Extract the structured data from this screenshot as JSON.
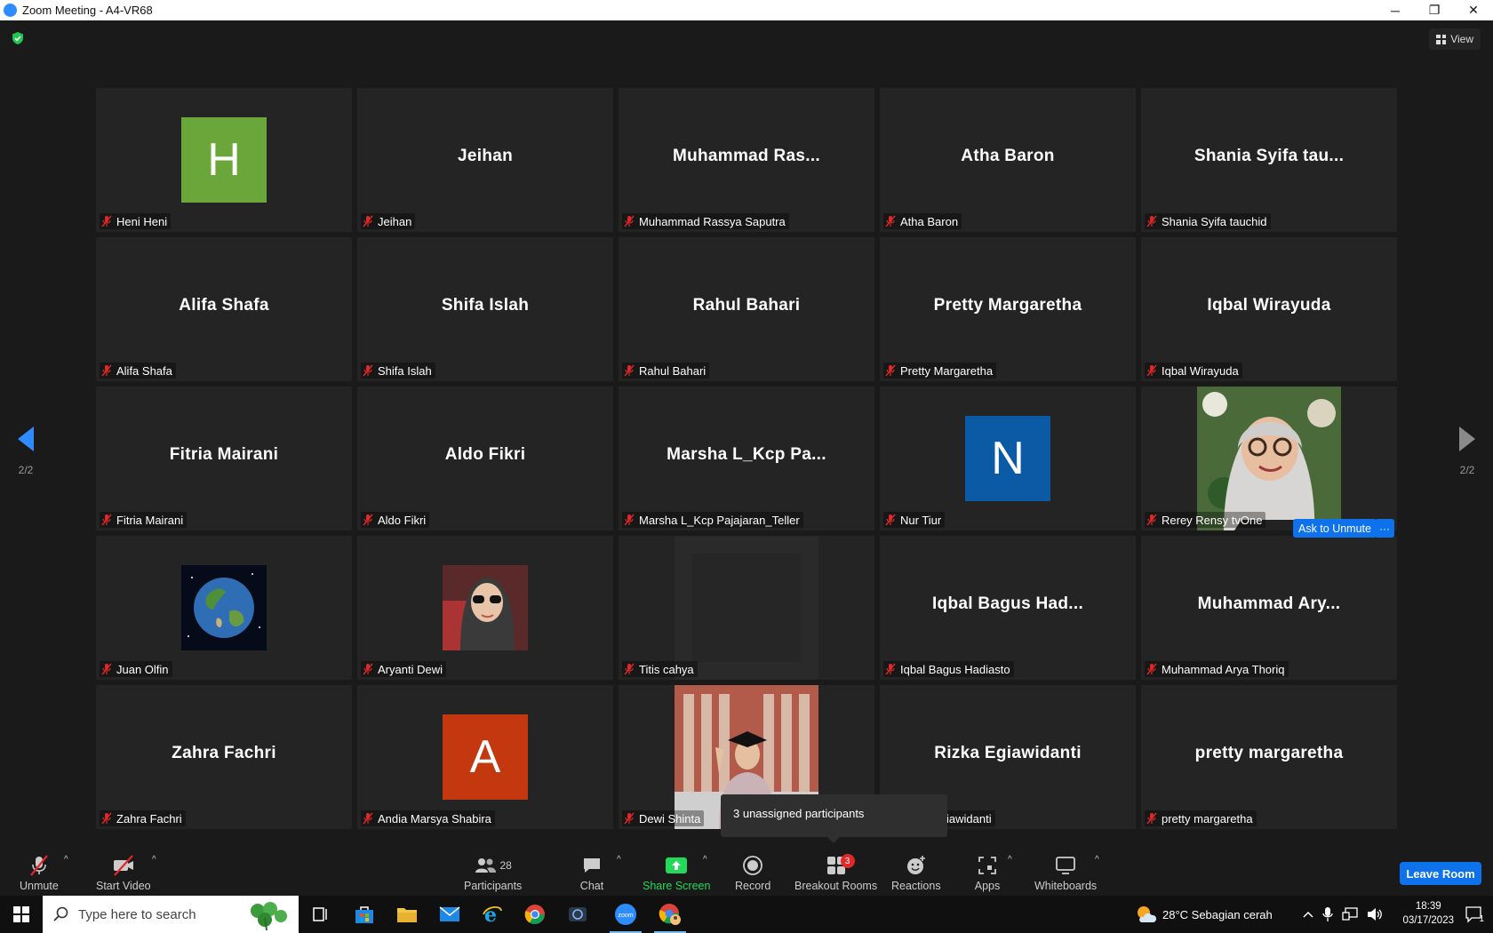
{
  "window": {
    "title": "Zoom Meeting - A4-VR68",
    "minimize": "─",
    "restore": "❐",
    "close": "✕"
  },
  "top": {
    "view_label": "View"
  },
  "pagination": {
    "prev_page": "2/2",
    "next_page": "2/2"
  },
  "tiles": [
    {
      "label": "Heni Heni",
      "type": "avatar",
      "letter": "H",
      "color": "#6aa63a"
    },
    {
      "label": "Jeihan",
      "type": "name",
      "display": "Jeihan"
    },
    {
      "label": "Muhammad Rassya Saputra",
      "type": "name",
      "display": "Muhammad  Ras..."
    },
    {
      "label": "Atha Baron",
      "type": "name",
      "display": "Atha Baron"
    },
    {
      "label": "Shania Syifa tauchid",
      "type": "name",
      "display": "Shania  Syifa  tau..."
    },
    {
      "label": "Alifa Shafa",
      "type": "name",
      "display": "Alifa Shafa"
    },
    {
      "label": "Shifa Islah",
      "type": "name",
      "display": "Shifa Islah"
    },
    {
      "label": "Rahul Bahari",
      "type": "name",
      "display": "Rahul Bahari"
    },
    {
      "label": "Pretty Margaretha",
      "type": "name",
      "display": "Pretty Margaretha"
    },
    {
      "label": "Iqbal Wirayuda",
      "type": "name",
      "display": "Iqbal Wirayuda"
    },
    {
      "label": "Fitria Mairani",
      "type": "name",
      "display": "Fitria Mairani"
    },
    {
      "label": "Aldo Fikri",
      "type": "name",
      "display": "Aldo Fikri"
    },
    {
      "label": "Marsha L_Kcp Pajajaran_Teller",
      "type": "name",
      "display": "Marsha  L_Kcp  Pa..."
    },
    {
      "label": "Nur Tiur",
      "type": "avatar",
      "letter": "N",
      "color": "#0b5aa6"
    },
    {
      "label": "Rerey Rensy tvOne",
      "type": "photo",
      "photo": "hijab-woman-glasses"
    },
    {
      "label": "Juan Olfin",
      "type": "earth",
      "photo": "earth"
    },
    {
      "label": "Aryanti Dewi",
      "type": "photo",
      "photo": "hijab-woman-sunglasses"
    },
    {
      "label": "Titis cahya",
      "type": "dark",
      "photo": "dark-video"
    },
    {
      "label": "Iqbal Bagus Hadiasto",
      "type": "name",
      "display": "Iqbal  Bagus  Had..."
    },
    {
      "label": "Muhammad Arya Thoriq",
      "type": "name",
      "display": "Muhammad  Ary..."
    },
    {
      "label": "Zahra Fachri",
      "type": "name",
      "display": "Zahra Fachri"
    },
    {
      "label": "Andia Marsya Shabira",
      "type": "avatar",
      "letter": "A",
      "color": "#c3380f"
    },
    {
      "label": "Dewi Shinta",
      "type": "photo",
      "photo": "graduation"
    },
    {
      "label": "Rizka Egiawidanti",
      "type": "name",
      "display": "Rizka Egiawidanti"
    },
    {
      "label": "pretty margaretha",
      "type": "name",
      "display": "pretty margaretha"
    }
  ],
  "hover_actions": {
    "ask_to_unmute": "Ask to Unmute",
    "more": "···"
  },
  "tooltip": {
    "text": "3 unassigned participants"
  },
  "toolbar": {
    "unmute": "Unmute",
    "start_video": "Start Video",
    "participants": "Participants",
    "participants_count": "28",
    "chat": "Chat",
    "share_screen": "Share Screen",
    "record": "Record",
    "breakout_rooms": "Breakout Rooms",
    "breakout_badge": "3",
    "reactions": "Reactions",
    "apps": "Apps",
    "whiteboards": "Whiteboards",
    "leave": "Leave Room",
    "caret": "^"
  },
  "taskbar": {
    "search_placeholder": "Type here to search",
    "weather": "28°C  Sebagian cerah",
    "time": "18:39",
    "date": "03/17/2023",
    "notification_count": "1"
  },
  "colors": {
    "accent": "#0e72ed",
    "muted_red": "#e02828",
    "share_green": "#23d959"
  }
}
